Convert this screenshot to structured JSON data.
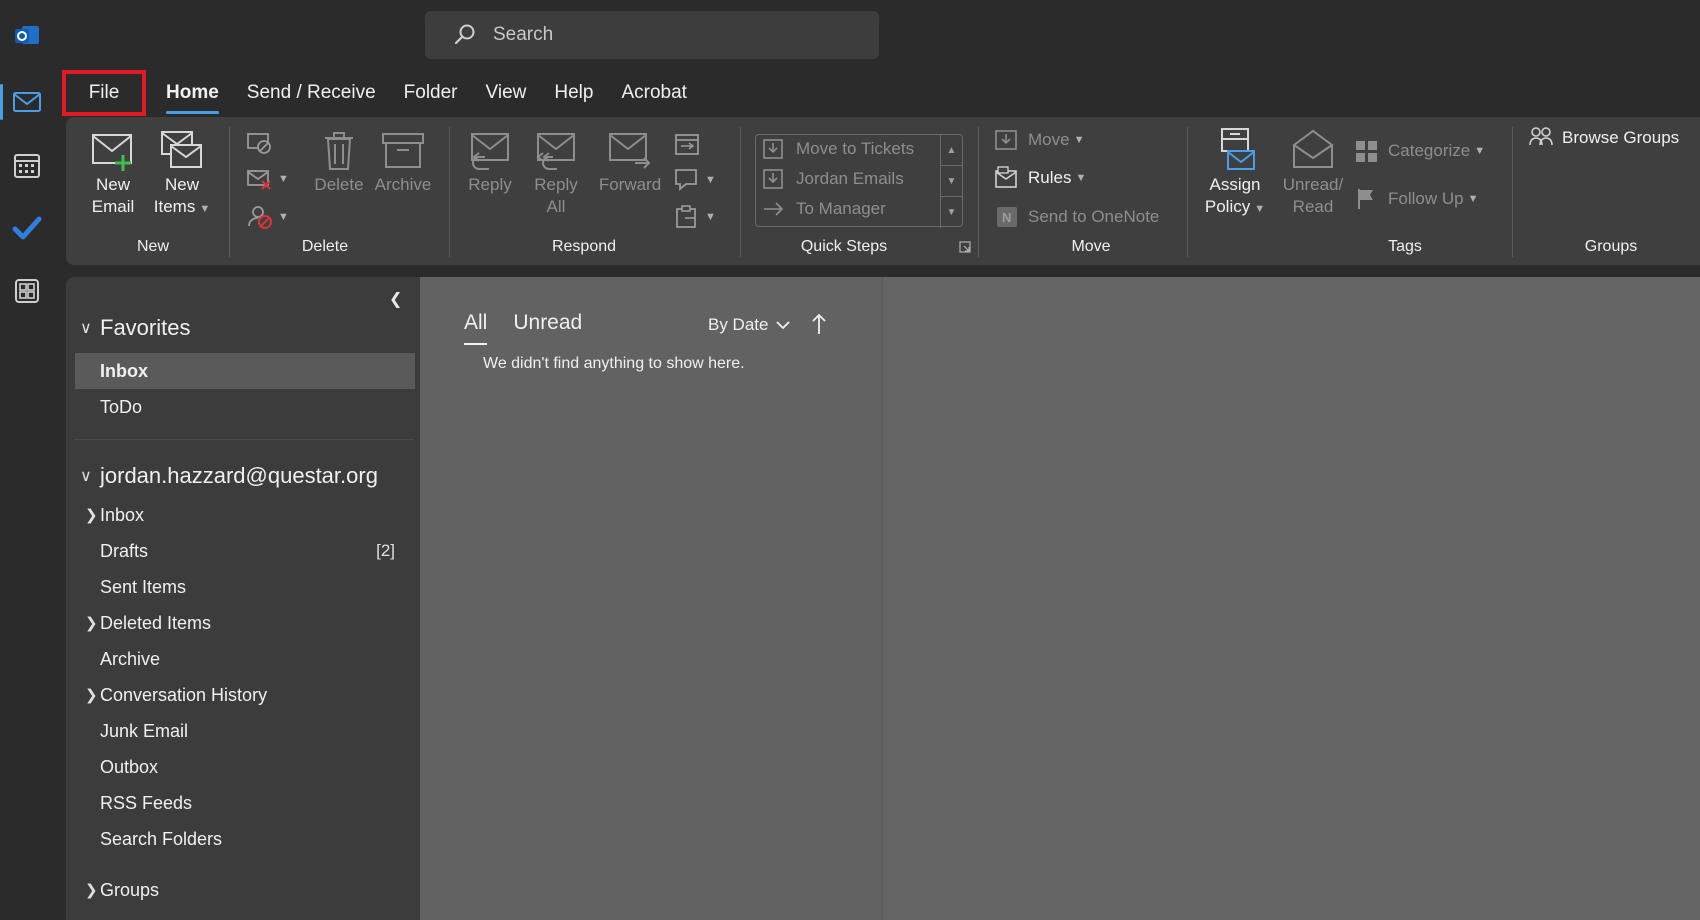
{
  "search": {
    "placeholder": "Search"
  },
  "tabs": [
    {
      "label": "File"
    },
    {
      "label": "Home"
    },
    {
      "label": "Send / Receive"
    },
    {
      "label": "Folder"
    },
    {
      "label": "View"
    },
    {
      "label": "Help"
    },
    {
      "label": "Acrobat"
    }
  ],
  "ribbon": {
    "groups": {
      "new": "New",
      "delete": "Delete",
      "respond": "Respond",
      "quick_steps": "Quick Steps",
      "move": "Move",
      "tags": "Tags",
      "groups": "Groups"
    },
    "new_email": {
      "line1": "New",
      "line2": "Email"
    },
    "new_items": {
      "line1": "New",
      "line2": "Items"
    },
    "delete": "Delete",
    "archive": "Archive",
    "reply": "Reply",
    "reply_all": {
      "line1": "Reply",
      "line2": "All"
    },
    "forward": "Forward",
    "quick_steps": [
      "Move to Tickets",
      "Jordan Emails",
      "To Manager"
    ],
    "move": "Move",
    "rules": "Rules",
    "send_to_onenote": "Send to OneNote",
    "assign_policy": {
      "line1": "Assign",
      "line2": "Policy"
    },
    "unread_read": {
      "line1": "Unread/",
      "line2": "Read"
    },
    "categorize": "Categorize",
    "follow_up": "Follow Up",
    "browse_groups": "Browse Groups"
  },
  "folders": {
    "favorites_header": "Favorites",
    "favorites": [
      {
        "name": "Inbox"
      },
      {
        "name": "ToDo"
      }
    ],
    "account": "jordan.hazzard@questar.org",
    "account_folders": [
      {
        "name": "Inbox"
      },
      {
        "name": "Drafts",
        "count": "[2]"
      },
      {
        "name": "Sent Items"
      },
      {
        "name": "Deleted Items"
      },
      {
        "name": "Archive"
      },
      {
        "name": "Conversation History"
      },
      {
        "name": "Junk Email"
      },
      {
        "name": "Outbox"
      },
      {
        "name": "RSS Feeds"
      },
      {
        "name": "Search Folders"
      }
    ],
    "groups_header": "Groups"
  },
  "message_list": {
    "tab_all": "All",
    "tab_unread": "Unread",
    "sort_label": "By Date",
    "empty_text": "We didn't find anything to show here."
  },
  "colors": {
    "accent": "#4a9ee8",
    "highlight_box": "#e01b24",
    "todo_check": "#2f7ee0"
  }
}
